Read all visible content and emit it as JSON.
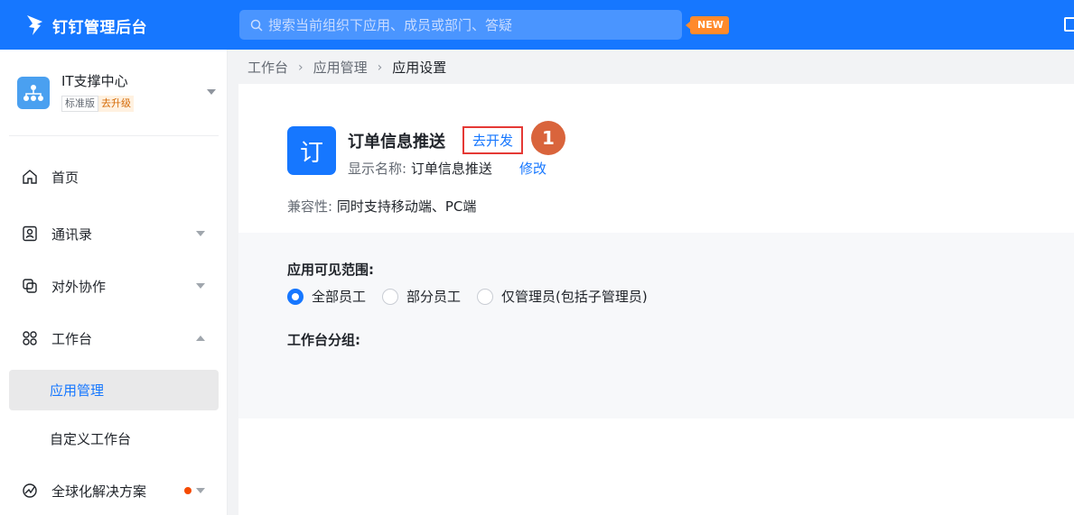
{
  "header": {
    "brand": "钉钉管理后台",
    "search_placeholder": "搜索当前组织下应用、成员或部门、答疑",
    "new_badge": "NEW"
  },
  "org": {
    "name": "IT支撑中心",
    "edition": "标准版",
    "upgrade": "去升级"
  },
  "sidebar": {
    "items": [
      {
        "label": "首页",
        "icon": "home-icon"
      },
      {
        "label": "通讯录",
        "icon": "contacts-icon"
      },
      {
        "label": "对外协作",
        "icon": "collaboration-icon"
      },
      {
        "label": "工作台",
        "icon": "workbench-icon"
      },
      {
        "label": "全球化解决方案",
        "icon": "globe-icon"
      }
    ],
    "sub_items": [
      {
        "label": "应用管理",
        "active": true
      },
      {
        "label": "自定义工作台",
        "active": false
      }
    ]
  },
  "breadcrumb": [
    "工作台",
    "应用管理",
    "应用设置"
  ],
  "app": {
    "icon_char": "订",
    "name": "订单信息推送",
    "dev_button": "去开发",
    "step_number": "1",
    "display_name_label": "显示名称:",
    "display_name_value": "订单信息推送",
    "edit_label": "修改",
    "compat_label": "兼容性:",
    "compat_value": "同时支持移动端、PC端"
  },
  "visibility": {
    "title": "应用可见范围:",
    "options": [
      {
        "label": "全部员工",
        "checked": true
      },
      {
        "label": "部分员工",
        "checked": false
      },
      {
        "label": "仅管理员(包括子管理员)",
        "checked": false
      }
    ]
  },
  "workbench_group": {
    "title": "工作台分组:"
  },
  "colors": {
    "primary": "#1677ff",
    "badge_orange": "#ff8a2b",
    "highlight_red": "#e53935",
    "step_badge": "#d9643c"
  }
}
